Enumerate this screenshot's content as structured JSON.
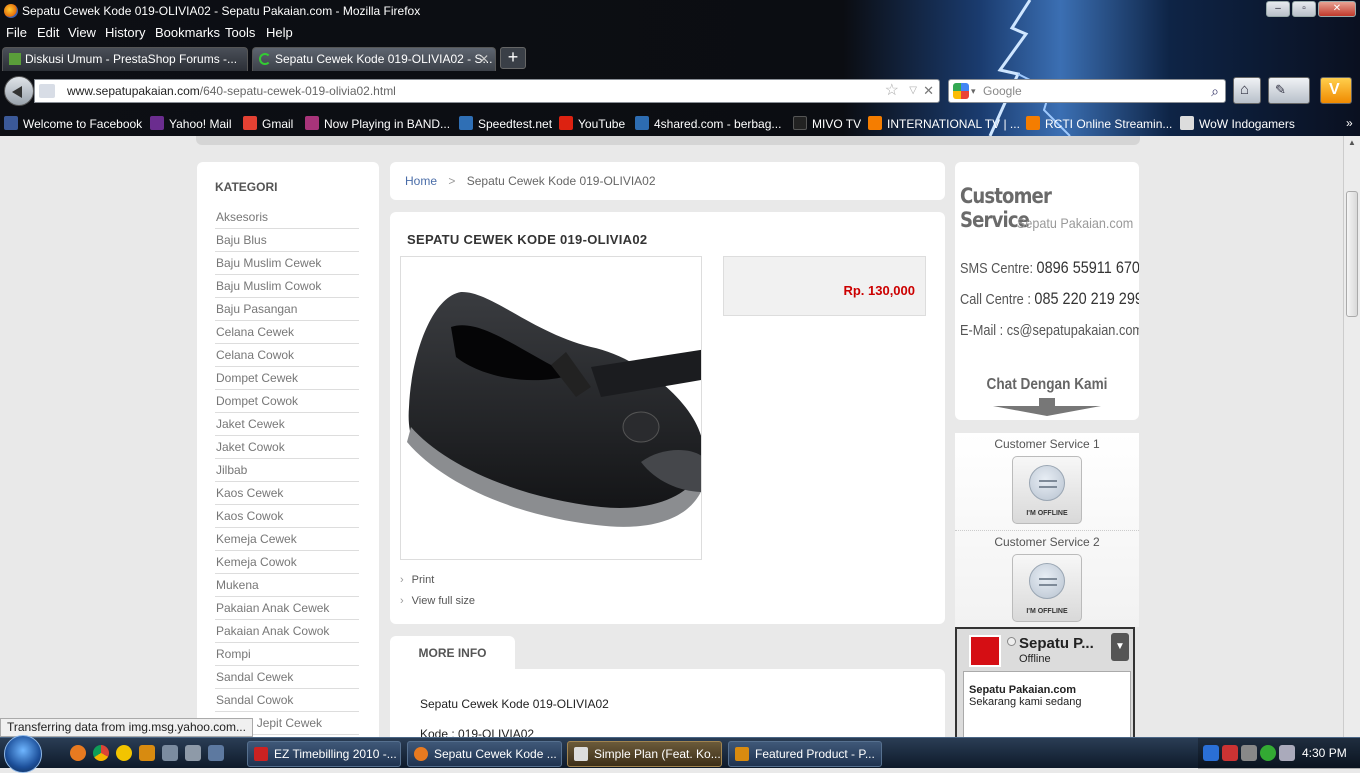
{
  "browser": {
    "window_title": "Sepatu Cewek Kode 019-OLIVIA02 - Sepatu Pakaian.com - Mozilla Firefox",
    "menu": [
      "File",
      "Edit",
      "View",
      "History",
      "Bookmarks",
      "Tools",
      "Help"
    ],
    "tabs": [
      {
        "label": "Diskusi Umum - PrestaShop Forums -...",
        "active": false
      },
      {
        "label": "Sepatu Cewek Kode 019-OLIVIA02 - S...",
        "active": true
      }
    ],
    "url_domain": "www.sepatupakaian.com",
    "url_path": "/640-sepatu-cewek-019-olivia02.html",
    "search_placeholder": "Google",
    "bookmarks": [
      "Welcome to Facebook",
      "Yahoo! Mail",
      "Gmail",
      "Now Playing in BAND...",
      "Speedtest.net",
      "YouTube",
      "4shared.com - berbag...",
      "MIVO TV",
      "INTERNATIONAL TV | ...",
      "RCTI Online Streamin...",
      "WoW Indogamers"
    ],
    "status_text": "Transferring data from img.msg.yahoo.com..."
  },
  "sidebar": {
    "title": "KATEGORI",
    "items": [
      "Aksesoris",
      "Baju Blus",
      "Baju Muslim Cewek",
      "Baju Muslim Cowok",
      "Baju Pasangan",
      "Celana Cewek",
      "Celana Cowok",
      "Dompet Cewek",
      "Dompet Cowok",
      "Jaket Cewek",
      "Jaket Cowok",
      "Jilbab",
      "Kaos Cewek",
      "Kaos Cowok",
      "Kemeja Cewek",
      "Kemeja Cowok",
      "Mukena",
      "Pakaian Anak Cewek",
      "Pakaian Anak Cowok",
      "Rompi",
      "Sandal Cewek",
      "Sandal Cowok",
      "Sandal Jepit Cewek"
    ]
  },
  "breadcrumb": {
    "home": "Home",
    "separator": ">",
    "current": "Sepatu Cewek Kode 019-OLIVIA02"
  },
  "product": {
    "title": "SEPATU CEWEK KODE 019-OLIVIA02",
    "price": "Rp. 130,000",
    "links": [
      "Print",
      "View full size"
    ]
  },
  "more_info": {
    "tab_label": "MORE INFO",
    "lines": [
      "Sepatu Cewek Kode 019-OLIVIA02",
      "Kode : 019-OLIVIA02"
    ]
  },
  "customer_service": {
    "title": "Customer Service",
    "subtitle": "Sepatu Pakaian.com",
    "sms_label": "SMS Centre:",
    "sms_value": "0896 55911 670",
    "call_label": "Call Centre :",
    "call_value": "085 220 219 299",
    "email_label": "E-Mail :",
    "email_value": "cs@sepatupakaian.com",
    "chat": "Chat Dengan Kami",
    "agents": [
      {
        "label": "Customer Service 1",
        "status": "I'M OFFLINE"
      },
      {
        "label": "Customer Service 2",
        "status": "I'M OFFLINE"
      }
    ]
  },
  "messenger": {
    "name": "Sepatu P...",
    "status": "Offline",
    "msg_title": "Sepatu Pakaian.com",
    "msg_text": "Sekarang kami sedang"
  },
  "taskbar": {
    "tasks": [
      {
        "label": "EZ Timebilling 2010 -...",
        "active": false
      },
      {
        "label": "Sepatu Cewek Kode ...",
        "active": false
      },
      {
        "label": "Simple Plan (Feat. Ko...",
        "active": true
      },
      {
        "label": "Featured Product - P...",
        "active": false
      }
    ],
    "clock": "4:30 PM"
  },
  "colors": {
    "price": "#cc0000",
    "link": "#4a6da8",
    "brand_red": "#d50e14"
  }
}
